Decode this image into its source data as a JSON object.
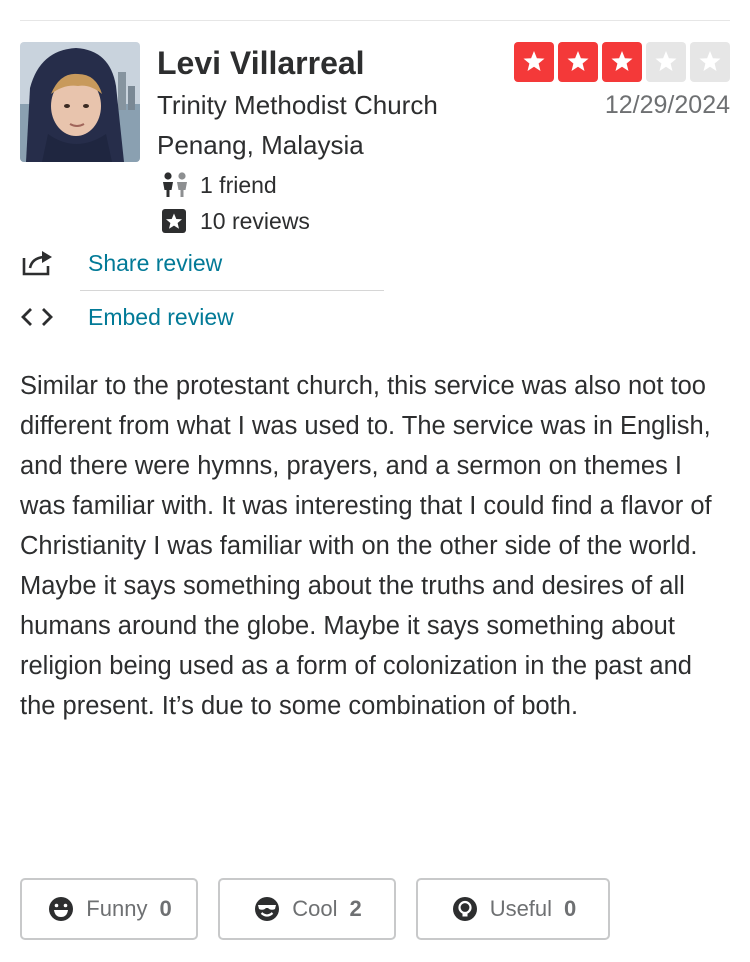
{
  "reviewer": {
    "name": "Levi Villarreal",
    "church": "Trinity Methodist Church",
    "location": "Penang, Malaysia",
    "friends": "1 friend",
    "reviews": "10 reviews",
    "friends_icon": "friends-icon",
    "reviews_icon": "star-square-icon"
  },
  "rating": {
    "value": 3,
    "max": 5,
    "active_color": "#f43939",
    "inactive_color": "#e6e6e6"
  },
  "date": "12/29/2024",
  "actions": {
    "share_label": "Share review",
    "embed_label": "Embed review",
    "share_icon": "share-icon",
    "embed_icon": "code-icon",
    "link_color": "#027a97"
  },
  "review": {
    "text": "Similar to the protestant church, this service was also not too different from what I was used to. The service was in English, and there were hymns, prayers, and a sermon on themes I was familiar with. It was interesting that I could find a flavor of Christianity I was familiar with on the other side of the world. Maybe it says something about the truths and desires of all humans around the globe. Maybe it says something about religion being used as a form of colonization in the past and the present. It’s due to some combination of both."
  },
  "votes": [
    {
      "label": "Funny",
      "count": "0",
      "icon": "funny-face-icon"
    },
    {
      "label": "Cool",
      "count": "2",
      "icon": "cool-face-icon"
    },
    {
      "label": "Useful",
      "count": "0",
      "icon": "lightbulb-icon"
    }
  ]
}
